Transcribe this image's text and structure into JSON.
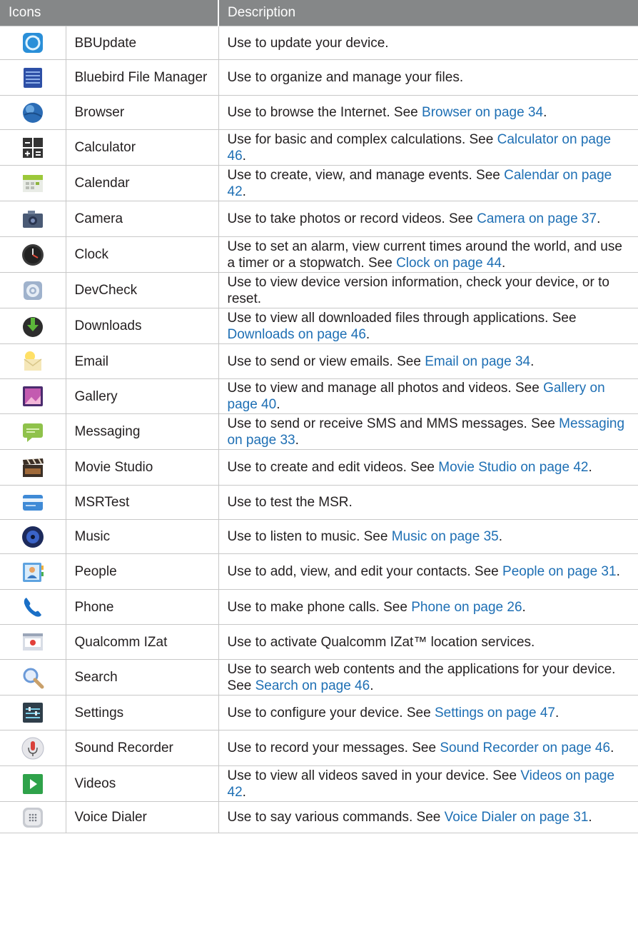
{
  "table": {
    "headers": {
      "icons": "Icons",
      "description": "Description"
    },
    "rows": [
      {
        "icon": "bbupdate-icon",
        "name": "BBUpdate",
        "desc": "Use to update your device.",
        "link": "",
        "tail": "",
        "h": 47
      },
      {
        "icon": "file-manager-icon",
        "name": "Bluebird File Manager",
        "desc": "Use to organize and manage your files.",
        "link": "",
        "tail": "",
        "h": 50
      },
      {
        "icon": "browser-icon",
        "name": "Browser",
        "desc": "Use to browse the Internet. See ",
        "link": "Browser on page 34",
        "tail": ".",
        "h": 48
      },
      {
        "icon": "calculator-icon",
        "name": "Calculator",
        "desc": "Use for basic and complex calculations. See ",
        "link": "Calculator on page 46",
        "tail": ".",
        "h": 50
      },
      {
        "icon": "calendar-icon",
        "name": "Calendar",
        "desc": "Use to create, view, and manage events. See ",
        "link": "Calendar on page 42",
        "tail": ".",
        "h": 50
      },
      {
        "icon": "camera-icon",
        "name": "Camera",
        "desc": "Use to take photos or record videos. See ",
        "link": "Camera on page 37",
        "tail": ".",
        "h": 50
      },
      {
        "icon": "clock-icon",
        "name": "Clock",
        "desc": "Use to set an alarm, view current times around the world, and use a timer or a stopwatch. See ",
        "link": "Clock on page 44",
        "tail": ".",
        "h": 50
      },
      {
        "icon": "devcheck-icon",
        "name": "DevCheck",
        "desc": "Use to view device version information, check your device, or to reset.",
        "link": "",
        "tail": "",
        "h": 50
      },
      {
        "icon": "downloads-icon",
        "name": "Downloads",
        "desc": "Use to view all downloaded files through applications. See ",
        "link": "Downloads on page 46",
        "tail": ".",
        "h": 50
      },
      {
        "icon": "email-icon",
        "name": "Email",
        "desc": "Use to send or view emails. See ",
        "link": "Email on page 34",
        "tail": ".",
        "h": 49
      },
      {
        "icon": "gallery-icon",
        "name": "Gallery",
        "desc": "Use to view and manage all photos and videos. See ",
        "link": "Gallery on page 40",
        "tail": ".",
        "h": 49
      },
      {
        "icon": "messaging-icon",
        "name": "Messaging",
        "desc": "Use to send or receive SMS and MMS messages. See ",
        "link": "Messaging on page 33",
        "tail": ".",
        "h": 50
      },
      {
        "icon": "movie-studio-icon",
        "name": "Movie Studio",
        "desc": "Use to create and edit videos. See ",
        "link": "Movie Studio on page 42",
        "tail": ".",
        "h": 50
      },
      {
        "icon": "msrtest-icon",
        "name": "MSRTest",
        "desc": "Use to test the MSR.",
        "link": "",
        "tail": "",
        "h": 48
      },
      {
        "icon": "music-icon",
        "name": "Music",
        "desc": "Use to listen to music. See ",
        "link": "Music on page 35",
        "tail": ".",
        "h": 48
      },
      {
        "icon": "people-icon",
        "name": "People",
        "desc": "Use to add, view, and edit your contacts. See ",
        "link": "People on page 31",
        "tail": ".",
        "h": 50
      },
      {
        "icon": "phone-icon",
        "name": "Phone",
        "desc": "Use to make phone calls. See ",
        "link": "Phone on page 26",
        "tail": ".",
        "h": 49
      },
      {
        "icon": "qualcomm-izat-icon",
        "name": "Qualcomm IZat",
        "desc": "Use to activate Qualcomm IZat™ location services.",
        "link": "",
        "tail": "",
        "h": 49
      },
      {
        "icon": "search-icon",
        "name": "Search",
        "desc": "Use to search web contents and the applications for your device. See ",
        "link": "Search on page 46",
        "tail": ".",
        "h": 50
      },
      {
        "icon": "settings-icon",
        "name": "Settings",
        "desc": "Use to configure your device. See ",
        "link": "Settings on page 47",
        "tail": ".",
        "h": 49
      },
      {
        "icon": "sound-recorder-icon",
        "name": "Sound Recorder",
        "desc": "Use to record your messages. See ",
        "link": "Sound Recorder on page 46",
        "tail": ".",
        "h": 50
      },
      {
        "icon": "videos-icon",
        "name": "Videos",
        "desc": "Use to view all videos saved in your device. See ",
        "link": "Videos on page 42",
        "tail": ".",
        "h": 50
      },
      {
        "icon": "voice-dialer-icon",
        "name": "Voice Dialer",
        "desc": "Use to say various commands. See ",
        "link": "Voice Dialer on page 31",
        "tail": ".",
        "h": 44
      }
    ]
  }
}
